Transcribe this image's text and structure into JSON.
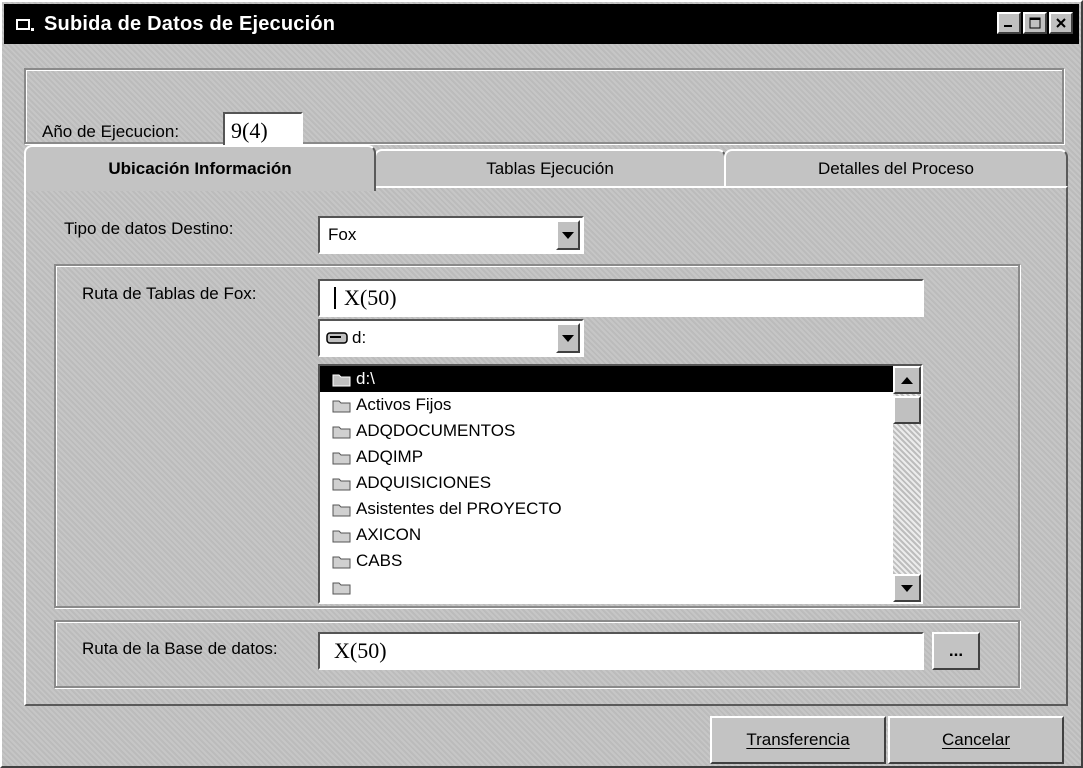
{
  "window": {
    "title": "Subida de Datos de Ejecución"
  },
  "year": {
    "label": "Año de Ejecucion:",
    "value": "9(4)"
  },
  "tabs": [
    {
      "label": "Ubicación Información"
    },
    {
      "label": "Tablas Ejecución"
    },
    {
      "label": "Detalles del Proceso"
    }
  ],
  "destino": {
    "label": "Tipo de datos Destino:",
    "value": "Fox"
  },
  "fox": {
    "label": "Ruta de Tablas de Fox:",
    "path_value": "X(50)",
    "drive_value": "d:",
    "selected_dir": "d:\\",
    "folders": [
      "Activos Fijos",
      "ADQDOCUMENTOS",
      "ADQIMP",
      "ADQUISICIONES",
      "Asistentes del PROYECTO",
      "AXICON",
      "CABS"
    ]
  },
  "db": {
    "label": "Ruta de la Base de datos:",
    "value": "X(50)",
    "browse_label": "..."
  },
  "buttons": {
    "transfer_label": "Transferencia",
    "cancel_label": "Cancelar"
  }
}
